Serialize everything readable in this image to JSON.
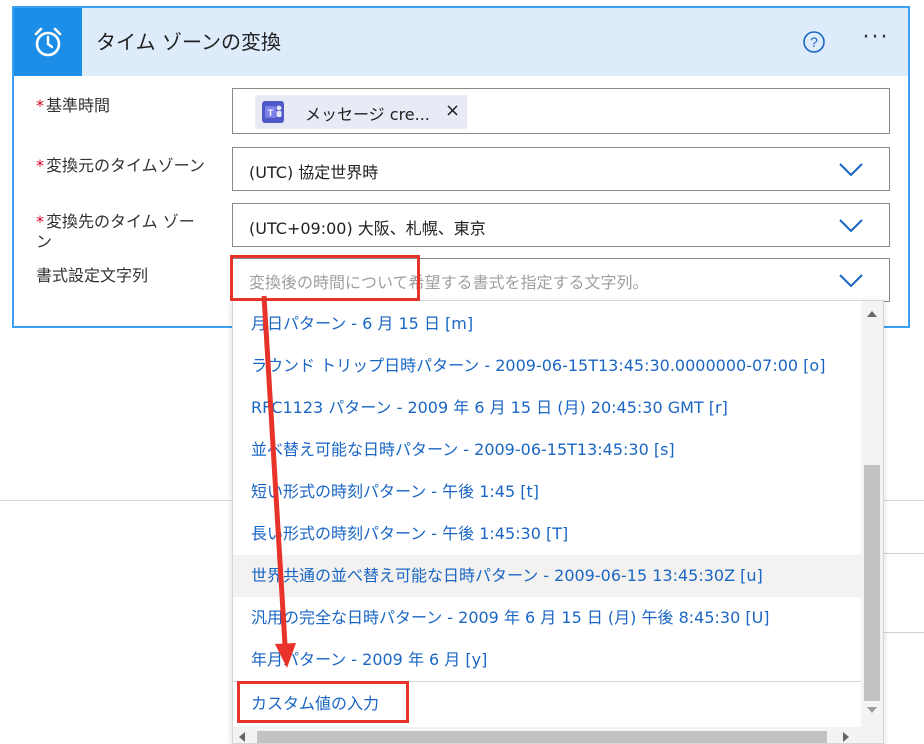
{
  "card": {
    "title": "タイム ゾーンの変換",
    "header_icon": "alarm-clock-icon",
    "help_icon": "help-circle-icon",
    "more_label": "···"
  },
  "fields": {
    "base_time": {
      "label": "基準時間",
      "required_mark": "*",
      "token_label": "メッセージ cre...",
      "token_icon": "teams-icon",
      "token_remove": "×"
    },
    "source_timezone": {
      "label": "変換元のタイムゾーン",
      "required_mark": "*",
      "value": "(UTC) 協定世界時"
    },
    "dest_timezone": {
      "label_line1": "変換先のタイム ゾー",
      "label_line2": "ン",
      "required_mark": "*",
      "value": "(UTC+09:00) 大阪、札幌、東京"
    },
    "format_string": {
      "label": "書式設定文字列",
      "placeholder": "変換後の時間について希望する書式を指定する文字列。"
    }
  },
  "dropdown": {
    "options": [
      "月日パターン - 6 月 15 日 [m]",
      "ラウンド トリップ日時パターン - 2009-06-15T13:45:30.0000000-07:00 [o]",
      "RFC1123 パターン - 2009 年 6 月 15 日 (月) 20:45:30 GMT [r]",
      "並べ替え可能な日時パターン - 2009-06-15T13:45:30 [s]",
      "短い形式の時刻パターン - 午後 1:45 [t]",
      "長い形式の時刻パターン - 午後 1:45:30 [T]",
      "世界共通の並べ替え可能な日時パターン - 2009-06-15 13:45:30Z [u]",
      "汎用の完全な日時パターン - 2009 年 6 月 15 日 (月) 午後 8:45:30 [U]",
      "年月パターン - 2009 年 6 月 [y]"
    ],
    "custom_option": "カスタム値の入力",
    "hovered_index": 6
  },
  "colors": {
    "accent": "#1d8ee8",
    "header_bg": "#ddebfb",
    "card_border": "#3aa0f3",
    "link": "#1a66c4",
    "annotation": "#e8332a"
  }
}
